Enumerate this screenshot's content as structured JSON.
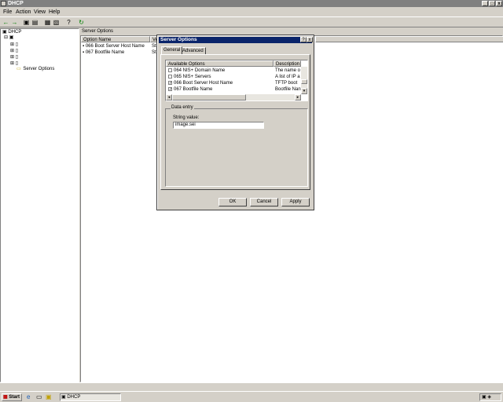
{
  "window": {
    "title": "DHCP"
  },
  "menu": [
    "File",
    "Action",
    "View",
    "Help"
  ],
  "tree": {
    "root": "DHCP",
    "selected": "Server Options"
  },
  "list": {
    "columns": [
      "Option Name",
      "Ve"
    ],
    "rows": [
      {
        "name": "066 Boot Server Host Name",
        "vendor": "St"
      },
      {
        "name": "067 Bootfile Name",
        "vendor": "St"
      }
    ],
    "header": "Server Options"
  },
  "dialog": {
    "title": "Server Options",
    "help_label": "?",
    "close_label": "x",
    "tabs": [
      "General",
      "Advanced"
    ],
    "columns": [
      "Available Options",
      "Description"
    ],
    "options": [
      {
        "name": "064 NIS+ Domain Name",
        "desc": "The name o",
        "checked": false
      },
      {
        "name": "065 NIS+ Servers",
        "desc": "A list of IP a",
        "checked": false
      },
      {
        "name": "066 Boot Server Host Name",
        "desc": "TFTP boot",
        "checked": true
      },
      {
        "name": "067 Bootfile Name",
        "desc": "Bootfile Nan",
        "checked": true
      }
    ],
    "data_entry": "Data entry",
    "string_label": "String value:",
    "string_value": "image.sei",
    "ok": "OK",
    "cancel": "Cancel",
    "apply": "Apply"
  },
  "taskbar": {
    "start": "Start",
    "task": "DHCP"
  },
  "colors": {
    "titlebar_inactive": "#808080",
    "dialog_title": "#0a246a",
    "face": "#d4d0c8"
  }
}
